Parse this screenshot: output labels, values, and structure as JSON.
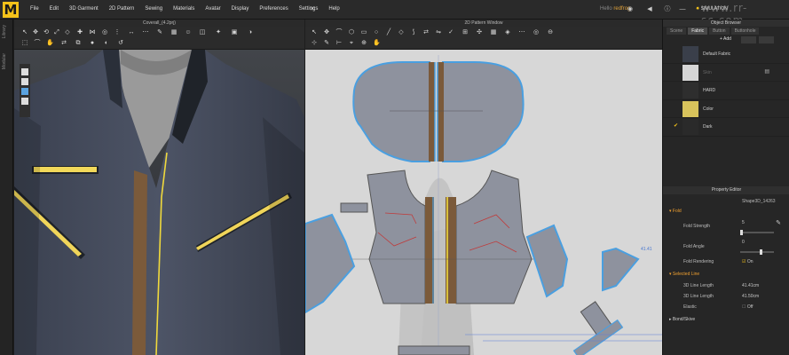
{
  "menubar": {
    "items": [
      "File",
      "Edit",
      "3D Garment",
      "2D Pattern",
      "Sewing",
      "Materials",
      "Avatar",
      "Display",
      "Preferences",
      "Settings",
      "Help"
    ],
    "user_prefix": "Hello",
    "user": "redfrog",
    "simulation_label": "SIMULATION",
    "watermark": "www.rr-sc.com"
  },
  "left_strip": {
    "tab1": "Library",
    "tab2": "Modular"
  },
  "viewport3d": {
    "title": "Coverall_(4.2prj)"
  },
  "pattern": {
    "title": "2D Pattern Window",
    "measure": "41.41"
  },
  "object_browser": {
    "title": "Object Browser",
    "tabs": [
      "Scene",
      "Fabric",
      "Button",
      "Buttonhole"
    ],
    "active_tab": "Fabric",
    "add_label": "+ Add",
    "fabrics": [
      {
        "name": "Default Fabric",
        "color": "#3a3f4a",
        "checked": false
      },
      {
        "name": "Skin",
        "color": "#d6d6d6",
        "checked": false
      },
      {
        "name": "HARD",
        "color": "#2e2e2e",
        "checked": false
      },
      {
        "name": "Color",
        "color": "#d8c35c",
        "checked": false
      },
      {
        "name": "Dark",
        "color": "#2a2a2a",
        "checked": true
      }
    ]
  },
  "property_editor": {
    "title": "Property Editor",
    "shape": "Shape3D_14263",
    "fold_section": "Fold",
    "fold_strength_label": "Fold Strength",
    "fold_strength_value": "5",
    "fold_strength_level": 0.05,
    "fold_angle_label": "Fold Angle",
    "fold_angle_value": "0",
    "fold_angle_level": 0.6,
    "fold_rendering_label": "Fold Rendering",
    "fold_rendering_value": "On",
    "selected_section": "Selected Line",
    "line_length_label": "3D Line Length",
    "line_length_value": "41.41cm",
    "line_length2_label": "3D Line Length",
    "line_length2_value": "41.50cm",
    "elastic_label": "Elastic",
    "elastic_value": "Off",
    "bond_section": "Bond/Skive"
  },
  "colors": {
    "accent": "#f4c21a",
    "pattern_bg": "#d7d7d7",
    "piece_fill": "#8e929e",
    "outline": "#4a9fe0"
  }
}
